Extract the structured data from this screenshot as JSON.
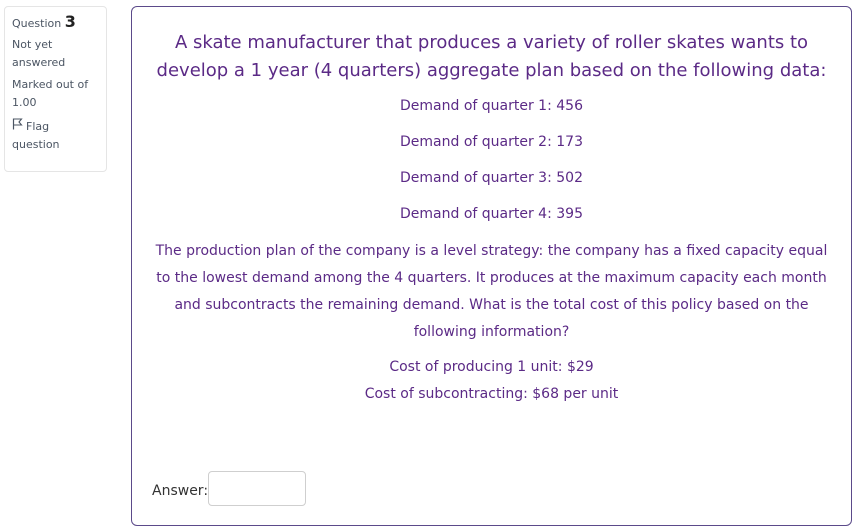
{
  "info": {
    "question_label": "Question",
    "question_number": "3",
    "state_line1": "Not yet",
    "state_line2": "answered",
    "grade_line1": "Marked out of",
    "grade_line2": "1.00",
    "flag_line1": "Flag",
    "flag_line2": "question",
    "flag_icon": "flag-icon"
  },
  "question": {
    "prompt": "A skate manufacturer that produces a variety of roller skates wants to develop a 1 year (4 quarters) aggregate plan based on the following data:",
    "demands": [
      "Demand of quarter 1: 456",
      "Demand of quarter 2: 173",
      "Demand of quarter 3: 502",
      "Demand of quarter 4: 395"
    ],
    "paragraph": "The production plan of the company is a level strategy: the company has a fixed capacity equal to the lowest demand among the 4 quarters. It produces at the maximum capacity each month and subcontracts the remaining demand. What is the total cost of this policy based on the following information?",
    "costs": [
      "Cost of producing 1 unit: $29",
      "Cost of subcontracting: $68 per unit"
    ],
    "answer_label": "Answer:",
    "answer_value": ""
  }
}
